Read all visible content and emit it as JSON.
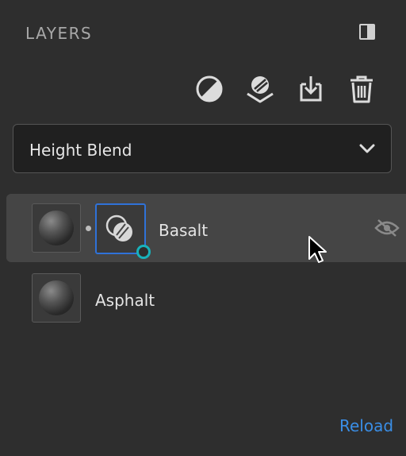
{
  "panel": {
    "title": "LAYERS",
    "toggle_icon": "panel-toggle-icon"
  },
  "toolbar": {
    "tools": [
      {
        "name": "adjustment-layer",
        "icon": "half-circle-icon"
      },
      {
        "name": "fill-layer",
        "icon": "fill-stack-icon"
      },
      {
        "name": "import",
        "icon": "import-tray-icon"
      },
      {
        "name": "delete",
        "icon": "trash-icon"
      }
    ]
  },
  "blend": {
    "selected": "Height Blend"
  },
  "layers": [
    {
      "name": "Basalt",
      "selected": true,
      "has_mask": true,
      "visible": false
    },
    {
      "name": "Asphalt",
      "selected": false,
      "has_mask": false
    }
  ],
  "footer": {
    "reload_label": "Reload"
  },
  "colors": {
    "accent": "#2f72d8",
    "link": "#3a8ee6",
    "mask_badge": "#18b2bb",
    "background": "#2e2e2e"
  }
}
